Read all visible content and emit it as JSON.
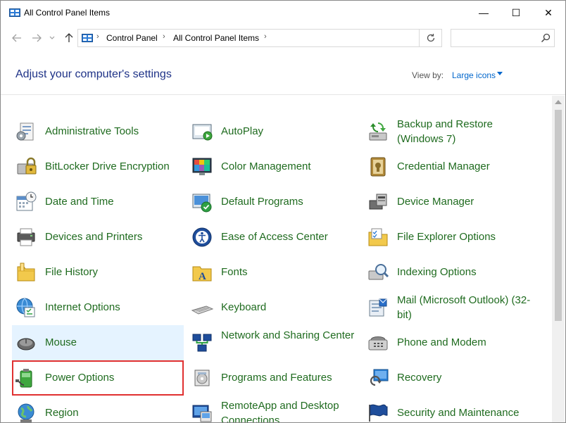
{
  "window": {
    "title": "All Control Panel Items",
    "minimize_glyph": "—",
    "maximize_glyph": "☐",
    "close_glyph": "✕"
  },
  "address": {
    "crumbs": [
      "Control Panel",
      "All Control Panel Items"
    ],
    "search_placeholder": ""
  },
  "header": {
    "title": "Adjust your computer's settings",
    "view_by_label": "View by:",
    "view_by_value": "Large icons"
  },
  "items": [
    {
      "label": "Administrative Tools",
      "icon": "admin-tools-icon"
    },
    {
      "label": "AutoPlay",
      "icon": "autoplay-icon"
    },
    {
      "label": "Backup and Restore (Windows 7)",
      "icon": "backup-restore-icon"
    },
    {
      "label": "BitLocker Drive Encryption",
      "icon": "bitlocker-icon"
    },
    {
      "label": "Color Management",
      "icon": "color-management-icon"
    },
    {
      "label": "Credential Manager",
      "icon": "credential-manager-icon"
    },
    {
      "label": "Date and Time",
      "icon": "date-time-icon"
    },
    {
      "label": "Default Programs",
      "icon": "default-programs-icon"
    },
    {
      "label": "Device Manager",
      "icon": "device-manager-icon"
    },
    {
      "label": "Devices and Printers",
      "icon": "devices-printers-icon"
    },
    {
      "label": "Ease of Access Center",
      "icon": "ease-of-access-icon"
    },
    {
      "label": "File Explorer Options",
      "icon": "file-explorer-options-icon"
    },
    {
      "label": "File History",
      "icon": "file-history-icon"
    },
    {
      "label": "Fonts",
      "icon": "fonts-icon"
    },
    {
      "label": "Indexing Options",
      "icon": "indexing-options-icon"
    },
    {
      "label": "Internet Options",
      "icon": "internet-options-icon"
    },
    {
      "label": "Keyboard",
      "icon": "keyboard-icon"
    },
    {
      "label": "Mail (Microsoft Outlook) (32-bit)",
      "icon": "mail-icon"
    },
    {
      "label": "Mouse",
      "icon": "mouse-icon"
    },
    {
      "label": "Network and Sharing Center",
      "icon": "network-sharing-icon"
    },
    {
      "label": "Phone and Modem",
      "icon": "phone-modem-icon"
    },
    {
      "label": "Power Options",
      "icon": "power-options-icon"
    },
    {
      "label": "Programs and Features",
      "icon": "programs-features-icon"
    },
    {
      "label": "Recovery",
      "icon": "recovery-icon"
    },
    {
      "label": "Region",
      "icon": "region-icon"
    },
    {
      "label": "RemoteApp and Desktop Connections",
      "icon": "remoteapp-icon"
    },
    {
      "label": "Security and Maintenance",
      "icon": "security-maintenance-icon"
    }
  ],
  "colors": {
    "link_green": "#1f6b1f",
    "title_blue": "#1e3287",
    "hover_bg": "#e5f3ff",
    "highlight_red": "#e03030"
  }
}
